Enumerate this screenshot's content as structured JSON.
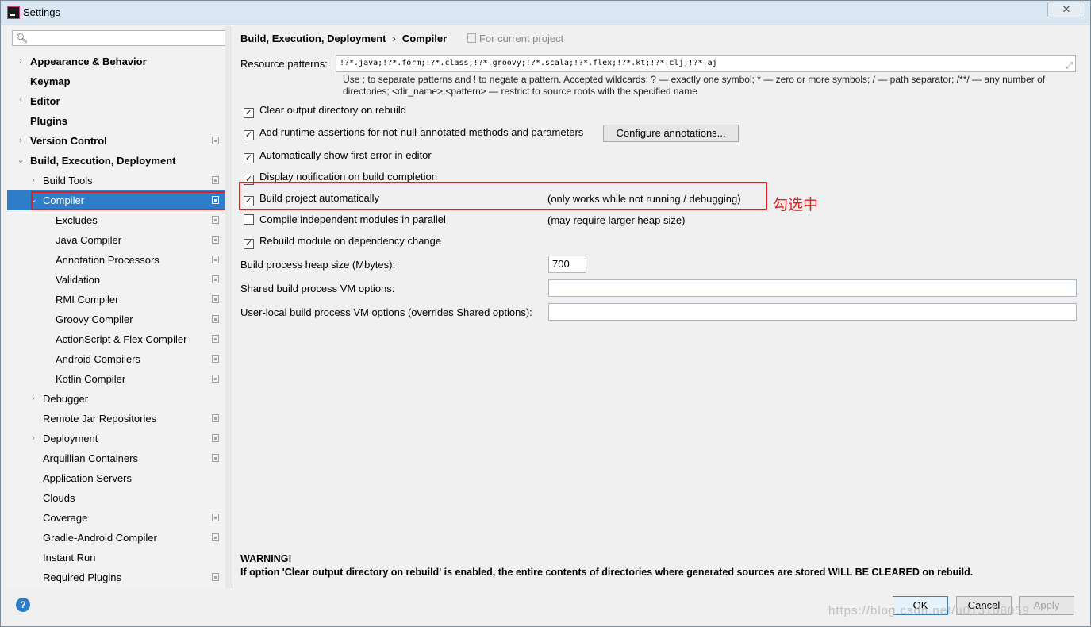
{
  "window": {
    "title": "Settings",
    "close_label": "✕"
  },
  "search": {
    "placeholder": "",
    "icon": "search-icon"
  },
  "sidebar": {
    "items": [
      {
        "label": "Appearance & Behavior",
        "arrow": "›",
        "bold": true
      },
      {
        "label": "Keymap",
        "arrow": "",
        "bold": true
      },
      {
        "label": "Editor",
        "arrow": "›",
        "bold": true
      },
      {
        "label": "Plugins",
        "arrow": "",
        "bold": true
      },
      {
        "label": "Version Control",
        "arrow": "›",
        "bold": true
      },
      {
        "label": "Build, Execution, Deployment",
        "arrow": "⌄",
        "bold": true
      },
      {
        "label": "Build Tools",
        "arrow": "›"
      },
      {
        "label": "Compiler",
        "arrow": "⌄",
        "selected": true
      },
      {
        "label": "Excludes"
      },
      {
        "label": "Java Compiler"
      },
      {
        "label": "Annotation Processors"
      },
      {
        "label": "Validation"
      },
      {
        "label": "RMI Compiler"
      },
      {
        "label": "Groovy Compiler"
      },
      {
        "label": "ActionScript & Flex Compiler"
      },
      {
        "label": "Android Compilers"
      },
      {
        "label": "Kotlin Compiler"
      },
      {
        "label": "Debugger",
        "arrow": "›"
      },
      {
        "label": "Remote Jar Repositories"
      },
      {
        "label": "Deployment",
        "arrow": "›"
      },
      {
        "label": "Arquillian Containers"
      },
      {
        "label": "Application Servers"
      },
      {
        "label": "Clouds"
      },
      {
        "label": "Coverage"
      },
      {
        "label": "Gradle-Android Compiler"
      },
      {
        "label": "Instant Run"
      },
      {
        "label": "Required Plugins"
      }
    ]
  },
  "main": {
    "breadcrumb": {
      "parent": "Build, Execution, Deployment",
      "separator": "›",
      "current": "Compiler"
    },
    "for_current_project": "For current project",
    "resource_patterns": {
      "label": "Resource patterns:",
      "value": "!?*.java;!?*.form;!?*.class;!?*.groovy;!?*.scala;!?*.flex;!?*.kt;!?*.clj;!?*.aj",
      "hint_line1": "Use ; to separate patterns and ! to negate a pattern. Accepted wildcards: ? — exactly one symbol; * — zero or more symbols; / — path separator; /**/ — any number of",
      "hint_line2": "directories; <dir_name>:<pattern> — restrict to source roots with the specified name"
    },
    "options": {
      "clear_output": "Clear output directory on rebuild",
      "runtime_assertions": "Add runtime assertions for not-null-annotated methods and parameters",
      "configure_annotations": "Configure annotations...",
      "show_first_error": "Automatically show first error in editor",
      "display_notification": "Display notification on build completion",
      "build_automatically": "Build project automatically",
      "build_automatically_note": "(only works while not running / debugging)",
      "compile_parallel": "Compile independent modules in parallel",
      "compile_parallel_note": "(may require larger heap size)",
      "rebuild_module": "Rebuild module on dependency change"
    },
    "heap": {
      "label": "Build process heap size (Mbytes):",
      "value": "700"
    },
    "shared_vm": {
      "label": "Shared build process VM options:",
      "value": ""
    },
    "user_vm": {
      "label": "User-local build process VM options (overrides Shared options):",
      "value": ""
    },
    "annotation_text": "勾选中",
    "warning_title": "WARNING!",
    "warning_body": "If option 'Clear output directory on rebuild' is enabled, the entire contents of directories where generated sources are stored WILL BE CLEARED on rebuild."
  },
  "footer": {
    "help": "?",
    "ok": "OK",
    "cancel": "Cancel",
    "apply": "Apply",
    "watermark": "https://blog.csdn.net/u013108059"
  },
  "colors": {
    "selection": "#2f7dc9",
    "annotation_red": "#e02020"
  }
}
